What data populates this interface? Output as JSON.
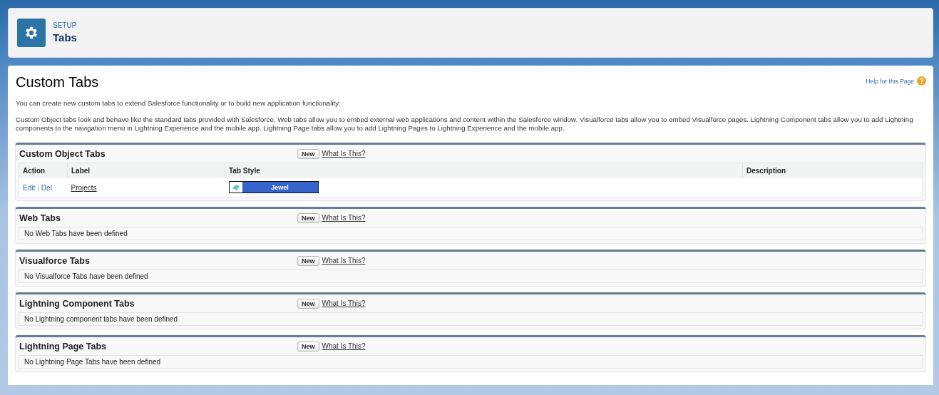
{
  "header": {
    "eyebrow": "SETUP",
    "title": "Tabs"
  },
  "page": {
    "title": "Custom Tabs",
    "help_link": "Help for this Page",
    "intro": "You can create new custom tabs to extend Salesforce functionality or to build new application functionality.",
    "description": "Custom Object tabs look and behave like the standard tabs provided with Salesforce. Web tabs allow you to embed external web applications and content within the Salesforce window. Visualforce tabs allow you to embed Visualforce pages. Lightning Component tabs allow you to add Lightning components to the navigation menu in Lightning Experience and the mobile app. Lightning Page tabs allow you to add Lightning Pages to Lightning Experience and the mobile app."
  },
  "sections": [
    {
      "kind": "table",
      "title": "Custom Object Tabs",
      "new_button": "New",
      "help_link": "What Is This?",
      "columns": [
        "Action",
        "Label",
        "Tab Style",
        "Description"
      ],
      "rows": [
        {
          "actions": [
            "Edit",
            "Del"
          ],
          "separator": "|",
          "label": "Projects",
          "tab_style": "Jewel"
        }
      ]
    },
    {
      "kind": "empty",
      "title": "Web Tabs",
      "new_button": "New",
      "help_link": "What Is This?",
      "message": "No Web Tabs have been defined"
    },
    {
      "kind": "empty",
      "title": "Visualforce Tabs",
      "new_button": "New",
      "help_link": "What Is This?",
      "message": "No Visualforce Tabs have been defined"
    },
    {
      "kind": "empty",
      "title": "Lightning Component Tabs",
      "new_button": "New",
      "help_link": "What Is This?",
      "message": "No Lightning component tabs have been defined"
    },
    {
      "kind": "empty",
      "title": "Lightning Page Tabs",
      "new_button": "New",
      "help_link": "What Is This?",
      "message": "No Lightning Page Tabs have been defined"
    }
  ]
}
